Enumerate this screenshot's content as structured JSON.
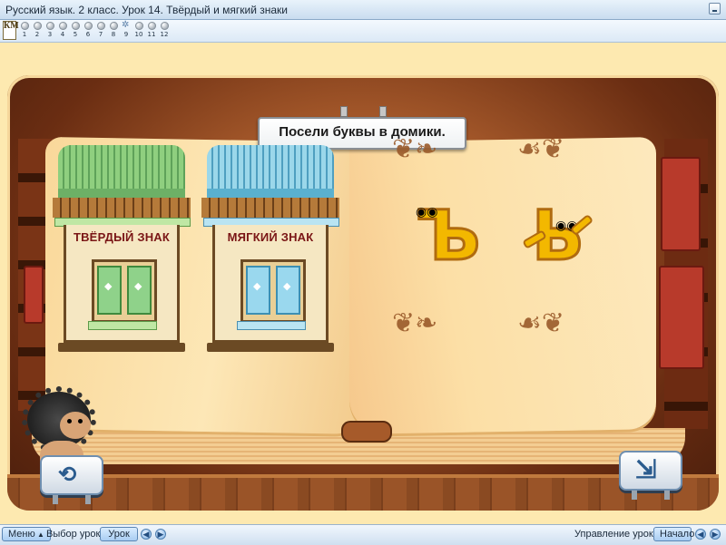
{
  "window": {
    "title": "Русский язык. 2 класс. Урок 14. Твёрдый и мягкий знаки"
  },
  "nav": {
    "logo_letters": "КМ",
    "steps": [
      "1",
      "2",
      "3",
      "4",
      "5",
      "6",
      "7",
      "8",
      "9",
      "10",
      "11",
      "12"
    ],
    "current_step": "9"
  },
  "lesson": {
    "instruction": "Посели буквы в домики.",
    "houses": [
      {
        "label": "ТВЁРДЫЙ ЗНАК",
        "color": "#8fcf7f"
      },
      {
        "label": "МЯГКИЙ ЗНАК",
        "color": "#9bd7ea"
      }
    ],
    "letters": [
      {
        "char": "Ъ",
        "meaning": "hard sign"
      },
      {
        "char": "Ь",
        "meaning": "soft sign"
      }
    ]
  },
  "bottombar": {
    "menu_label": "Меню",
    "lesson_select_label": "Выбор урока:",
    "lesson_button_label": "Урок",
    "control_label": "Управление уроком:",
    "start_button_label": "Начало"
  },
  "colors": {
    "accent": "#5b85b3",
    "letter_fill": "#f3b800",
    "sign_text": "#7a1616"
  }
}
